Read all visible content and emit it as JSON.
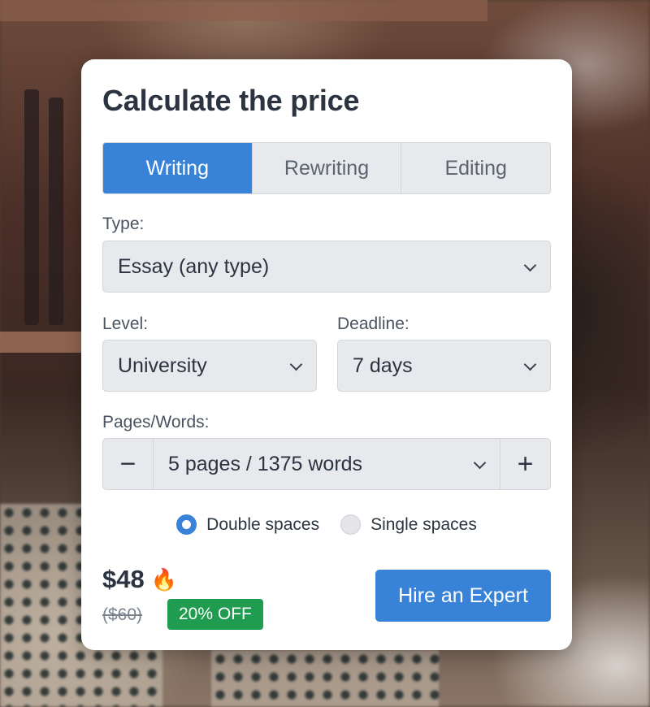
{
  "title": "Calculate the price",
  "tabs": [
    {
      "label": "Writing",
      "active": true
    },
    {
      "label": "Rewriting",
      "active": false
    },
    {
      "label": "Editing",
      "active": false
    }
  ],
  "type": {
    "label": "Type:",
    "value": "Essay (any type)"
  },
  "level": {
    "label": "Level:",
    "value": "University"
  },
  "deadline": {
    "label": "Deadline:",
    "value": "7 days"
  },
  "pages": {
    "label": "Pages/Words:",
    "value": "5 pages / 1375 words",
    "minus": "−",
    "plus": "+"
  },
  "spacing": {
    "options": [
      {
        "label": "Double spaces",
        "checked": true
      },
      {
        "label": "Single spaces",
        "checked": false
      }
    ]
  },
  "price": {
    "current": "$48",
    "icon": "fire-icon",
    "old": "($60)",
    "discount_badge": "20% OFF"
  },
  "cta": {
    "label": "Hire an Expert"
  },
  "colors": {
    "accent": "#3883d8",
    "badge": "#1f9c4f",
    "text": "#2b3440"
  }
}
